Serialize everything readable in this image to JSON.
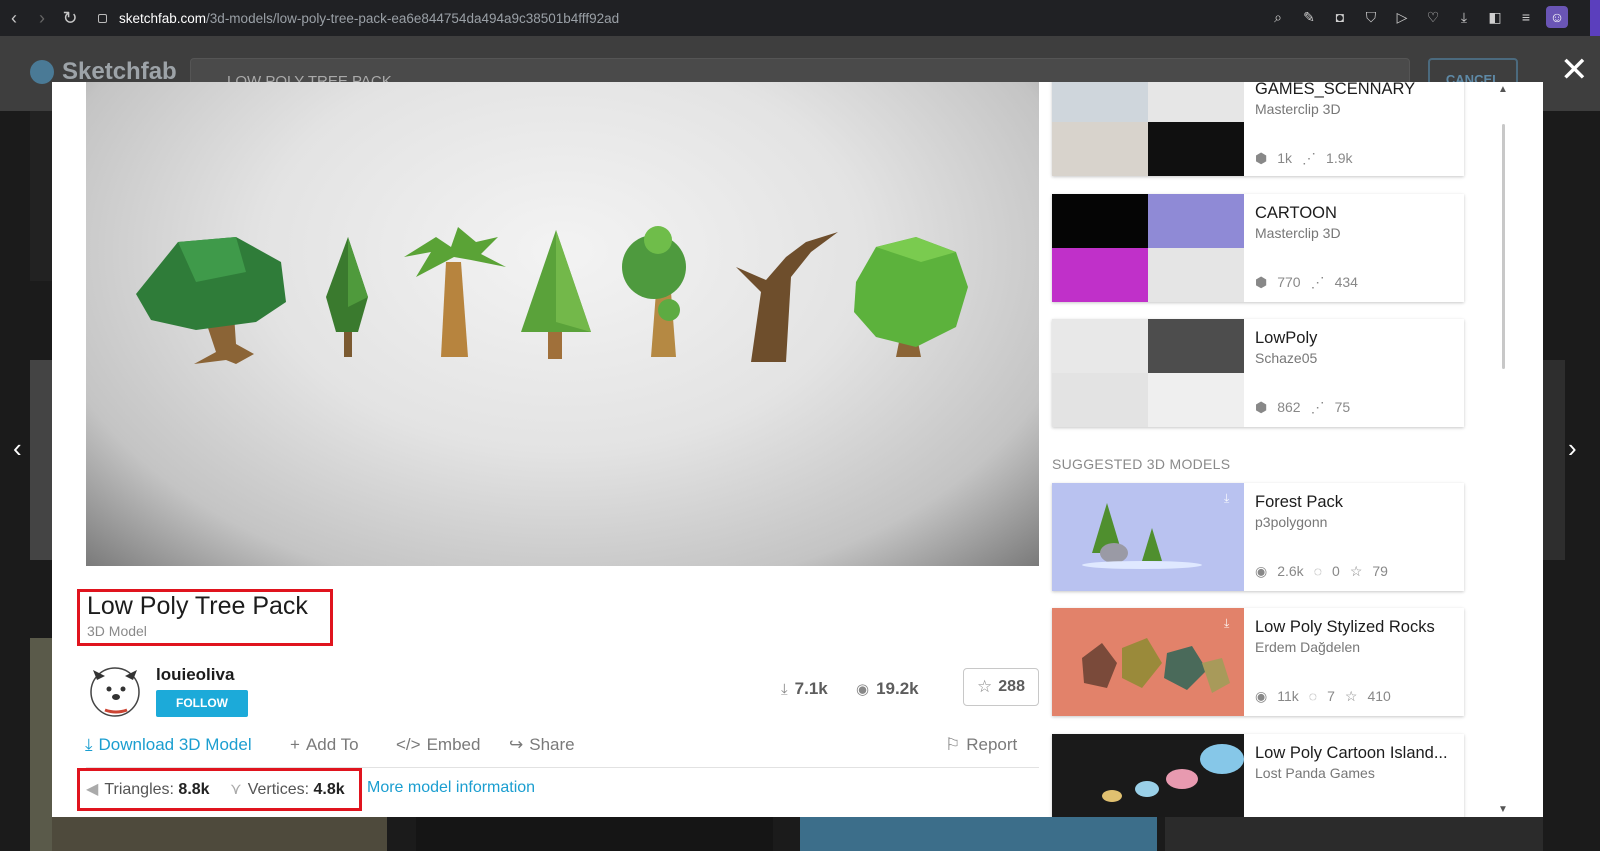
{
  "browser": {
    "url_domain": "sketchfab.com",
    "url_path": "/3d-models/low-poly-tree-pack-ea6e844754da494a9c38501b4fff92ad"
  },
  "background": {
    "logo": "Sketchfab",
    "search_value": "LOW POLY TREE PACK",
    "cancel_label": "CANCEL"
  },
  "model": {
    "title": "Low Poly Tree Pack",
    "type": "3D Model",
    "author": "louieoliva",
    "follow_label": "FOLLOW",
    "downloads": "7.1k",
    "views": "19.2k",
    "likes": "288",
    "actions": {
      "download": "Download 3D Model",
      "add_to": "Add To",
      "embed": "Embed",
      "share": "Share",
      "report": "Report"
    },
    "specs": {
      "triangles_label": "Triangles:",
      "triangles_value": "8.8k",
      "vertices_label": "Vertices:",
      "vertices_value": "4.8k",
      "more_info": "More model information"
    }
  },
  "collections": [
    {
      "title": "GAMES_SCENNARY",
      "author": "Masterclip 3D",
      "models": "1k",
      "views": "1.9k"
    },
    {
      "title": "CARTOON",
      "author": "Masterclip 3D",
      "models": "770",
      "views": "434"
    },
    {
      "title": "LowPoly",
      "author": "Schaze05",
      "models": "862",
      "views": "75"
    }
  ],
  "suggested_heading": "SUGGESTED 3D MODELS",
  "suggested": [
    {
      "title": "Forest Pack",
      "author": "p3polygonn",
      "views": "2.6k",
      "comments": "0",
      "likes": "79"
    },
    {
      "title": "Low Poly Stylized Rocks",
      "author": "Erdem Dağdelen",
      "views": "11k",
      "comments": "7",
      "likes": "410"
    },
    {
      "title": "Low Poly Cartoon Island...",
      "author": "Lost Panda Games"
    }
  ],
  "colors": {
    "accent": "#1caad9",
    "link": "#1b9ed0",
    "highlight_box": "#e0141e"
  }
}
